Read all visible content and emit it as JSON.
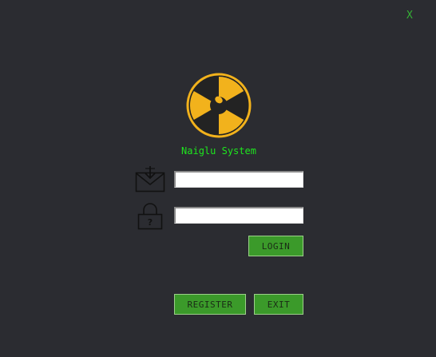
{
  "window": {
    "close_label": "X"
  },
  "app": {
    "title": "Naiglu System",
    "logo_icon": "radiation-icon"
  },
  "form": {
    "email_icon": "mail-download-icon",
    "email_value": "",
    "password_icon": "padlock-question-icon",
    "password_value": "",
    "login_label": "LOGIN"
  },
  "footer": {
    "register_label": "REGISTER",
    "exit_label": "EXIT"
  },
  "colors": {
    "background": "#2b2c31",
    "accent_yellow": "#f2b21c",
    "title_green": "#1ee61e",
    "button_green": "#3b9a2a",
    "close_green": "#35b035"
  },
  "lock_glyph": "?"
}
